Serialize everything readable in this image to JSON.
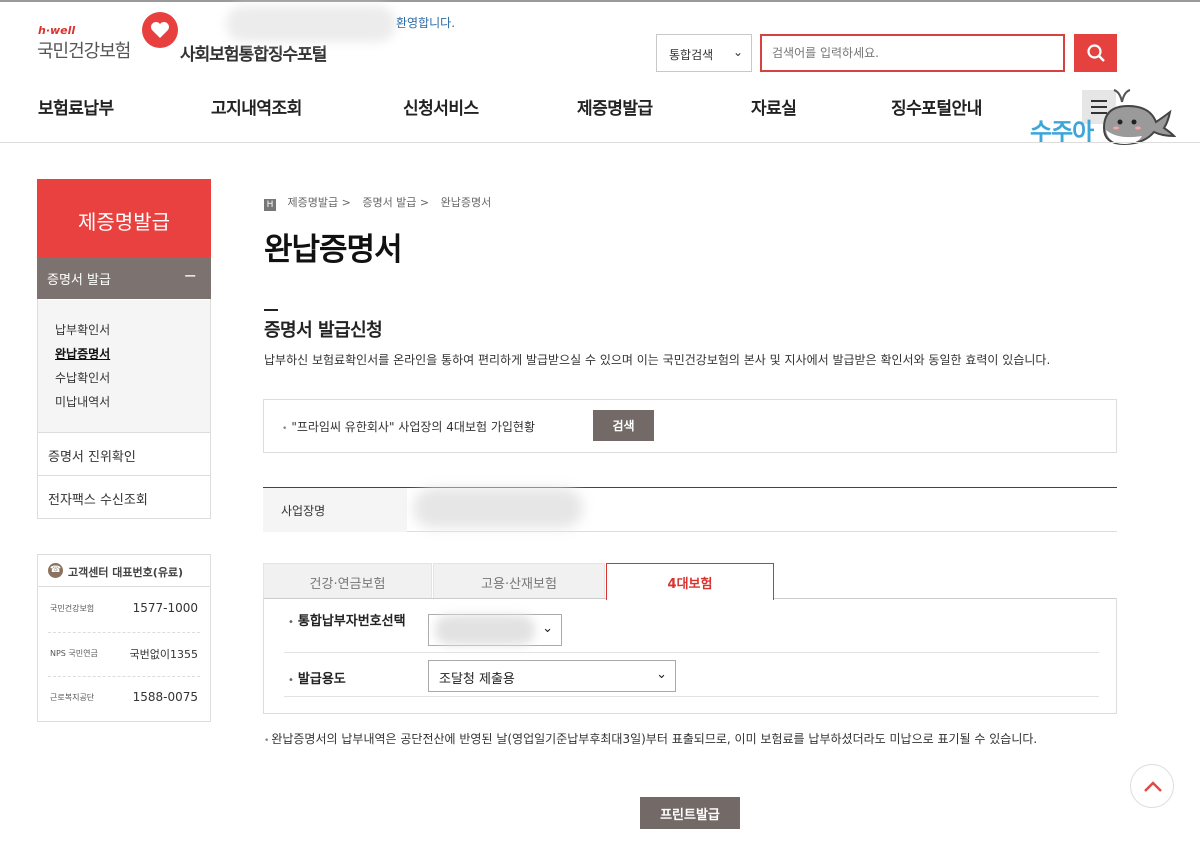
{
  "header": {
    "logo_top": "h·well",
    "logo_org": "국민건강보험",
    "portal_title": "사회보험통합징수포털",
    "notice_tail": "환영합니다.",
    "search_scope": "통합검색",
    "search_placeholder": "검색어를 입력하세요.",
    "search_icon": "magnifier-icon",
    "menu_icon": "hamburger-icon",
    "mascot_text": "수주아"
  },
  "gnb": [
    "보험료납부",
    "고지내역조회",
    "신청서비스",
    "제증명발급",
    "자료실",
    "징수포털안내"
  ],
  "sidebar": {
    "title": "제증명발급",
    "group": "증명서 발급",
    "group_toggle": "−",
    "sub_items": [
      "납부확인서",
      "완납증명서",
      "수납확인서",
      "미납내역서"
    ],
    "items": [
      "증명서 진위확인",
      "전자팩스 수신조회"
    ]
  },
  "customer_center": {
    "title": "고객센터 대표번호(유료)",
    "rows": [
      {
        "logo": "국민건강보험",
        "number": "1577-1000"
      },
      {
        "logo": "NPS 국민연금",
        "number": "국번없이1355"
      },
      {
        "logo": "근로복지공단",
        "number": "1588-0075"
      }
    ]
  },
  "main": {
    "breadcrumb": [
      "제증명발급 >",
      "증명서 발급 >",
      "완납증명서"
    ],
    "title": "완납증명서",
    "section_title": "증명서 발급신청",
    "description": "납부하신 보험료확인서를 온라인을 통하여 편리하게 발급받으실 수 있으며 이는 국민건강보험의 본사 및 지사에서 발급받은 확인서와 동일한 효력이 있습니다.",
    "company_line": "\"프라임씨 유한회사\" 사업장의 4대보험 가입현황",
    "company_button": "검색",
    "biz_label": "사업장명",
    "tabs": [
      "건강·연금보험",
      "고용·산재보험",
      "4대보험"
    ],
    "active_tab": "4대보험",
    "form": {
      "label1": "통합납부자번호선택",
      "label2": "발급용도",
      "purpose_value": "조달청 제출용"
    },
    "note": "완납증명서의 납부내역은 공단전산에 반영된 날(영업일기준납부후최대3일)부터 표출되므로, 이미 보험료를 납부하셨더라도 미납으로 표기될 수 있습니다.",
    "print_button": "프린트발급"
  },
  "colors": {
    "accent": "#e8413f",
    "dark_button": "#736a67",
    "sidebar_sub": "#7c7370"
  }
}
